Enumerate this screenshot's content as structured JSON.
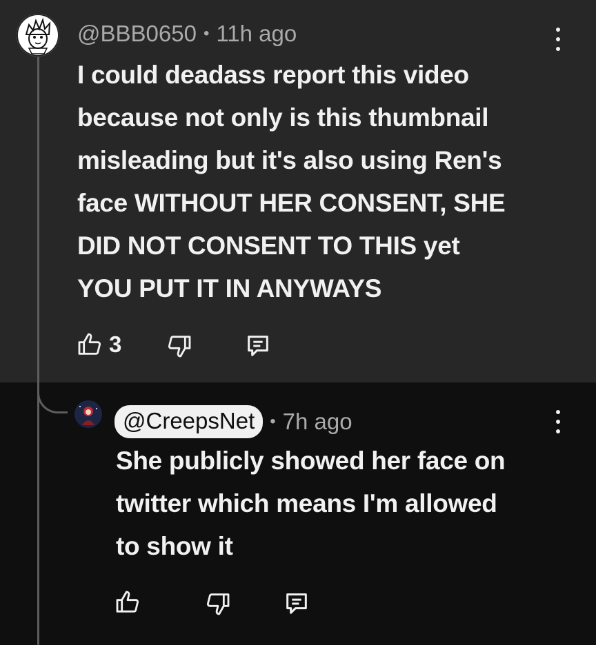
{
  "comment": {
    "handle": "@BBB0650",
    "separator": "•",
    "time": "11h ago",
    "lines": [
      "I could deadass report this video",
      "because not only is this thumbnail",
      "misleading but it's also using Ren's",
      "face WITHOUT HER CONSENT, SHE",
      "DID NOT CONSENT TO THIS yet",
      "YOU PUT IT IN ANYWAYS"
    ],
    "like_count": "3",
    "icons": [
      "thumb-up-icon",
      "thumb-down-icon",
      "reply-icon",
      "more-vert-icon"
    ]
  },
  "reply": {
    "handle": "@CreepsNet",
    "separator": "•",
    "time": "7h ago",
    "lines": [
      "She publicly showed her face on",
      "twitter which means I'm allowed",
      "to show it"
    ],
    "icons": [
      "thumb-up-icon",
      "thumb-down-icon",
      "reply-icon",
      "more-vert-icon"
    ]
  },
  "colors": {
    "comment_bg": "#272727",
    "reply_bg": "#0f0f0f",
    "text": "#f1f1f1",
    "meta": "#aaaaaa",
    "thread_line": "#5e5e5e"
  }
}
